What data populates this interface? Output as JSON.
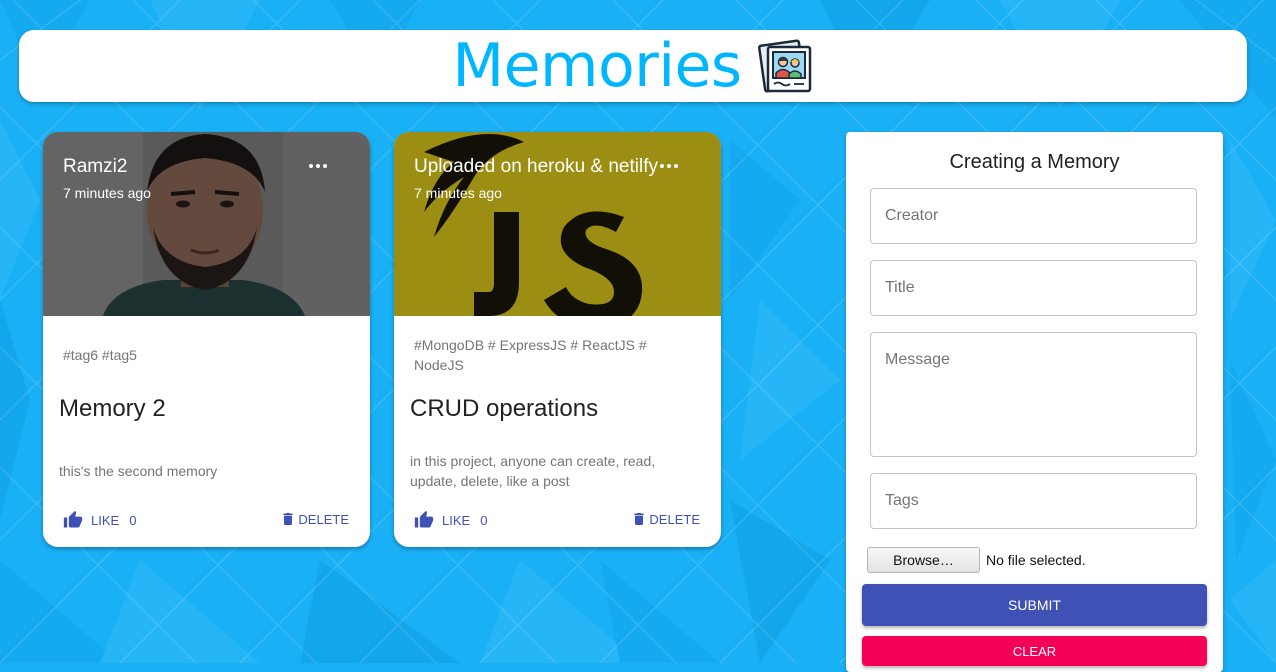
{
  "header": {
    "title": "Memories",
    "logo_icon": "memories-photo-logo-icon"
  },
  "posts": [
    {
      "creator": "Ramzi2",
      "time": "7 minutes ago",
      "tags": "#tag6 #tag5",
      "title": "Memory 2",
      "message": "this's the second memory",
      "like_label": "LIKE",
      "like_count": "0",
      "delete_label": "DELETE",
      "image_subject": "portrait-photo"
    },
    {
      "creator": "Uploaded on heroku & netilfy",
      "time": "7 minutes ago",
      "tags": "#MongoDB # ExpressJS # ReactJS # NodeJS",
      "title": "CRUD operations",
      "message": "in this project, anyone can create, read, update, delete, like a post",
      "like_label": "LIKE",
      "like_count": "0",
      "delete_label": "DELETE",
      "image_subject": "javascript-logo-image"
    }
  ],
  "form": {
    "title": "Creating a Memory",
    "creator_placeholder": "Creator",
    "title_placeholder": "Title",
    "message_placeholder": "Message",
    "tags_placeholder": "Tags",
    "browse_label": "Browse…",
    "file_status": "No file selected.",
    "submit_label": "SUBMIT",
    "clear_label": "CLEAR"
  },
  "colors": {
    "background": "#1ab0f5",
    "title": "#00b7ff",
    "primary": "#3f51b5",
    "secondary": "#f50057"
  }
}
